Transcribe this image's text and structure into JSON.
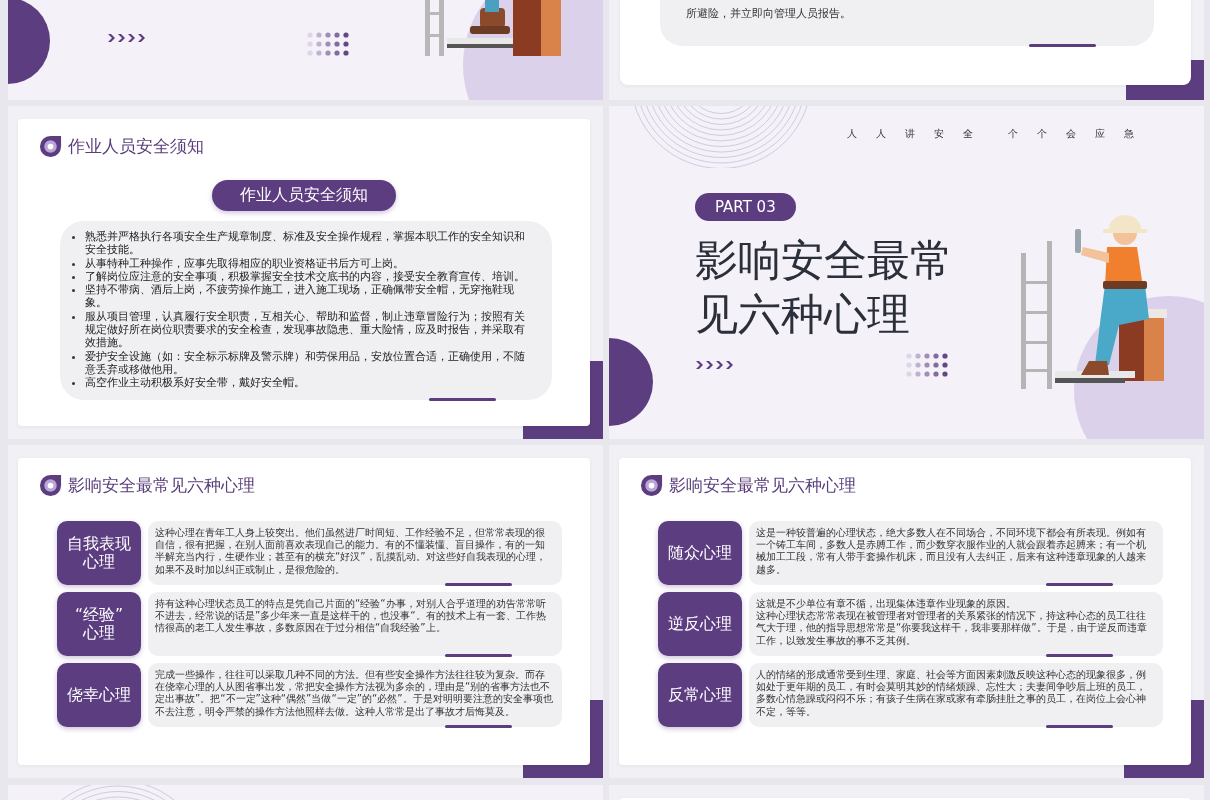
{
  "slides": [
    {
      "kind": "cover-bottom"
    },
    {
      "kind": "text-bottom",
      "paragraph": "所避险，并立即向管理人员报告。"
    },
    {
      "kind": "bullets",
      "heading": "作业人员安全须知",
      "banner": "作业人员安全须知",
      "bullets": [
        "熟悉并严格执行各项安全生产规章制度、标准及安全操作规程，掌握本职工作的安全知识和安全技能。",
        "从事特种工种操作，应事先取得相应的职业资格证书后方可上岗。",
        "了解岗位应注意的安全事项，积极掌握安全技术交底书的内容，接受安全教育宣传、培训。",
        "坚持不带病、酒后上岗，不疲劳操作施工，进入施工现场，正确佩带安全帽，无穿拖鞋现象。",
        "服从项目管理，认真履行安全职责，互相关心、帮助和监督，制止违章冒险行为；按照有关规定做好所在岗位职责要求的安全检查，发现事故隐患、重大险情，应及时报告，并采取有效措施。",
        "爱护安全设施（如：安全标示标牌及警示牌）和劳保用品，安放位置合适，正确使用，不随意丢弃或移做他用。",
        "高空作业主动积极系好安全带，戴好安全帽。"
      ]
    },
    {
      "kind": "section",
      "slogans": [
        "人人讲安全",
        "个个会应急"
      ],
      "part": "PART 03",
      "title_lines": [
        "影响安全最常",
        "见六种心理"
      ]
    },
    {
      "kind": "cards",
      "heading": "影响安全最常见六种心理",
      "items": [
        {
          "label": [
            "自我表现",
            "心理"
          ],
          "text": [
            "这种心理在青年工人身上较突出。他们虽然进厂时间短、工作经验不足，但常常表现的很自信，很有把握，在别人面前喜欢表现自己的能力。有的不懂装懂、盲目操作，有的一知半解充当内行，生硬作业；甚至有的横充“好汉”，乱摸乱动。对这些好自我表现的心理，如果不及时加以纠正或制止，是很危险的。"
          ]
        },
        {
          "label": [
            "“经验”",
            "心理"
          ],
          "text": [
            "持有这种心理状态员工的特点是凭自己片面的“经验“办事，对别人合乎道理的劝告常常听不进去，经常说的话是”多少年来一直是这样干的，也没事“。有的技术上有一套、工作热情很高的老工人发生事故，多数原因在于过分相信“自我经验”上。"
          ]
        },
        {
          "label": [
            "侥幸心理"
          ],
          "text": [
            "完成一些操作，往往可以采取几种不同的方法。但有些安全操作方法往往较为复杂。而存在侥幸心理的人从图省事出发，常把安全操作方法视为多余的，理由是“别的省事方法也不定出事故”。把“不一定”这种“偶然”当做“一定”的“必然”。于是对明明要注意的安全事项也不去注意，明令严禁的操作方法他照样去做。这种人常常是出了事故才后悔莫及。"
          ]
        }
      ]
    },
    {
      "kind": "cards",
      "heading": "影响安全最常见六种心理",
      "items": [
        {
          "label": [
            "随众心理"
          ],
          "text": [
            "这是一种较普遍的心理状态，绝大多数人在不同场合，不同环境下都会有所表现。例如有一个铸工车间，多数人是赤膊工作，而少数穿衣服作业的人就会跟着赤起膊来；有一个机械加工工段，常有人带手套操作机床，而且没有人去纠正，后来有这种违章现象的人越来越多。"
          ]
        },
        {
          "label": [
            "逆反心理"
          ],
          "text": [
            "这就是不少单位有章不循，出现集体违章作业现象的原因。",
            "这种心理状态常常表现在被管理者对管理者的关系紧张的情况下，持这种心态的员工往往气大于理，他的指导思想常常是“你要我这样干，我非要那样做”。于是，由于逆反而违章工作，以致发生事故的事不乏其例。"
          ]
        },
        {
          "label": [
            "反常心理"
          ],
          "text": [
            "人的情绪的形成通常受到生理、家庭、社会等方面因素刺激反映这种心态的现象很多，例如处于更年期的员工，有时会莫明其妙的情绪烦躁、忘性大；夫妻间争吵后上班的员工，多数心情急躁或闷闷不乐；有孩子生病在家或家有牵肠挂肚之事的员工，在岗位上会心神不定，等等。"
          ]
        }
      ]
    },
    {
      "kind": "cover-top"
    },
    {
      "kind": "blank-top"
    }
  ]
}
